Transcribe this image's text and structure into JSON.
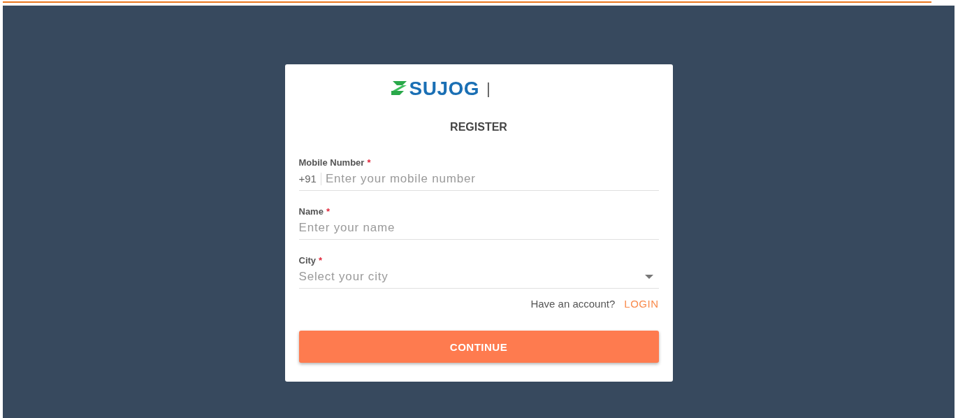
{
  "logo": {
    "text": "SUJOG",
    "separator": "|"
  },
  "title": "REGISTER",
  "fields": [
    {
      "kind": "phone",
      "label": "Mobile Number",
      "required_mark": "*",
      "prefix": "+91",
      "placeholder": "Enter your mobile number"
    },
    {
      "kind": "text",
      "label": "Name",
      "required_mark": "*",
      "placeholder": "Enter your name"
    },
    {
      "kind": "select",
      "label": "City",
      "required_mark": "*",
      "placeholder": "Select your city"
    }
  ],
  "account_prompt": "Have an account?",
  "login_link": "LOGIN",
  "continue_button": "CONTINUE"
}
